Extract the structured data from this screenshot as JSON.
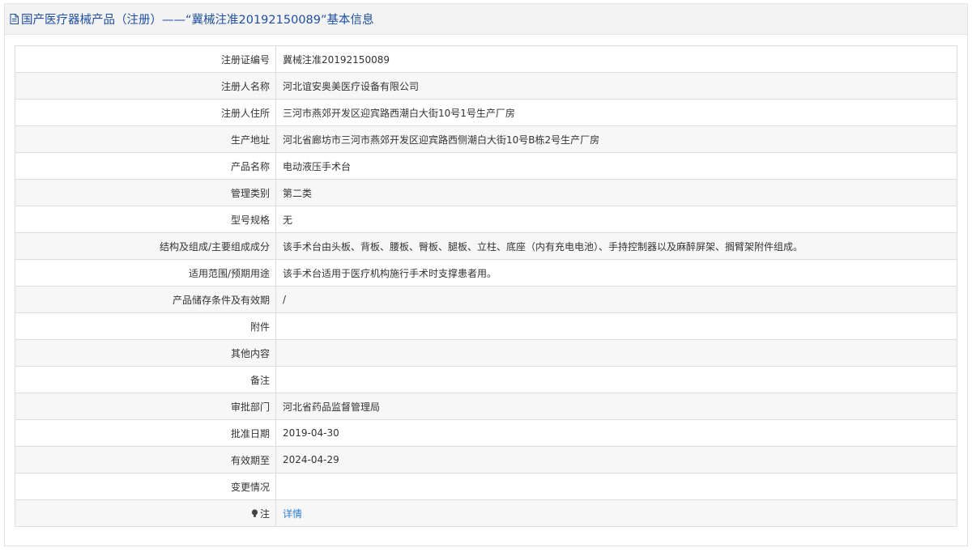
{
  "header": {
    "title": "国产医疗器械产品（注册）——“冀械注准20192150089”基本信息"
  },
  "rows": [
    {
      "label": "注册证编号",
      "value": "冀械注准20192150089"
    },
    {
      "label": "注册人名称",
      "value": "河北谊安奥美医疗设备有限公司"
    },
    {
      "label": "注册人住所",
      "value": "三河市燕郊开发区迎宾路西潮白大街10号1号生产厂房"
    },
    {
      "label": "生产地址",
      "value": "河北省廊坊市三河市燕郊开发区迎宾路西侧潮白大街10号B栋2号生产厂房"
    },
    {
      "label": "产品名称",
      "value": "电动液压手术台"
    },
    {
      "label": "管理类别",
      "value": "第二类"
    },
    {
      "label": "型号规格",
      "value": "无"
    },
    {
      "label": "结构及组成/主要组成成分",
      "value": "该手术台由头板、背板、腰板、臀板、腿板、立柱、底座（内有充电电池）、手持控制器以及麻醉屏架、搁臂架附件组成。"
    },
    {
      "label": "适用范围/预期用途",
      "value": "该手术台适用于医疗机构施行手术时支撑患者用。"
    },
    {
      "label": "产品储存条件及有效期",
      "value": "/"
    },
    {
      "label": "附件",
      "value": ""
    },
    {
      "label": "其他内容",
      "value": ""
    },
    {
      "label": "备注",
      "value": ""
    },
    {
      "label": "审批部门",
      "value": "河北省药品监督管理局"
    },
    {
      "label": "批准日期",
      "value": "2019-04-30"
    },
    {
      "label": "有效期至",
      "value": "2024-04-29"
    },
    {
      "label": "变更情况",
      "value": ""
    }
  ],
  "note": {
    "label": "注",
    "icon": "bulb-icon",
    "link_text": "详情"
  },
  "colors": {
    "title": "#1f4fa0",
    "link": "#2d7dd2",
    "header_bg": "#f3f3f3",
    "row_alt_bg": "#f7f7f7",
    "border": "#dcdcdc"
  }
}
